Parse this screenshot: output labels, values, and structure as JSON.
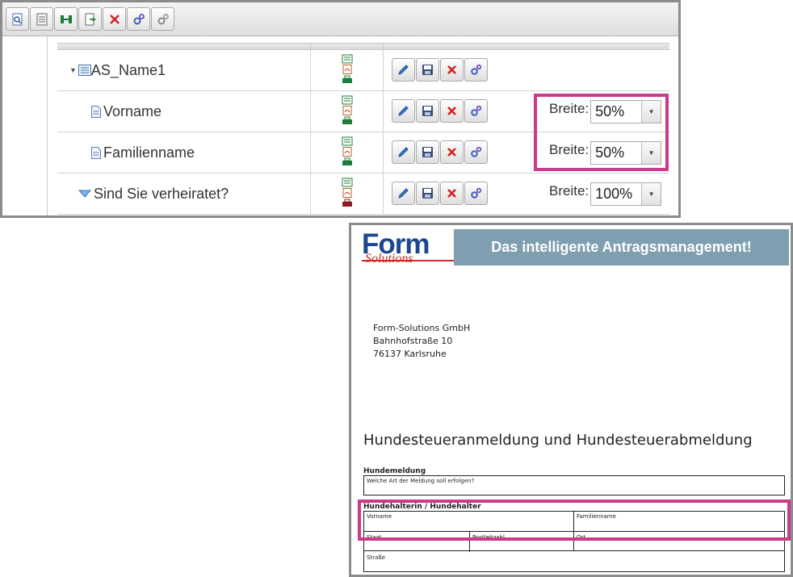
{
  "toolbar": {
    "buttons": [
      {
        "name": "preview-icon"
      },
      {
        "name": "form-icon"
      },
      {
        "name": "structure-icon"
      },
      {
        "name": "export-icon"
      },
      {
        "name": "delete-icon"
      },
      {
        "name": "settings-blue-icon"
      },
      {
        "name": "settings-gray-icon"
      }
    ]
  },
  "tree": {
    "rows": [
      {
        "label": "AS_Name1",
        "type": "group",
        "breite_label": "",
        "breite_value": ""
      },
      {
        "label": "Vorname",
        "type": "field",
        "breite_label": "Breite:",
        "breite_value": "50%"
      },
      {
        "label": "Familienname",
        "type": "field",
        "breite_label": "Breite:",
        "breite_value": "50%"
      },
      {
        "label": "Sind Sie verheiratet?",
        "type": "select",
        "breite_label": "Breite:",
        "breite_value": "100%"
      }
    ]
  },
  "document": {
    "logo_text": "Form",
    "logo_sub": "Solutions",
    "logo_reg": "®",
    "banner": "Das intelligente Antragsmanagement!",
    "address": [
      "Form-Solutions GmbH",
      "Bahnhofstraße 10",
      "76137 Karlsruhe"
    ],
    "title": "Hundesteueranmeldung und Hundesteuerabmeldung",
    "section1": {
      "label": "Hundemeldung",
      "field": "Welche Art der Meldung soll erfolgen?"
    },
    "section2": {
      "label": "Hundehalterin / Hundehalter",
      "vorname": "Vorname",
      "familienname": "Familienname",
      "staat": "Staat",
      "postleitzahl": "Postleitzahl",
      "ort": "Ort",
      "strasse": "Straße"
    }
  },
  "colors": {
    "highlight": "#cc3a8a",
    "banner": "#7f9fb0",
    "logo_blue": "#1d4691",
    "logo_red": "#d02a2a"
  }
}
